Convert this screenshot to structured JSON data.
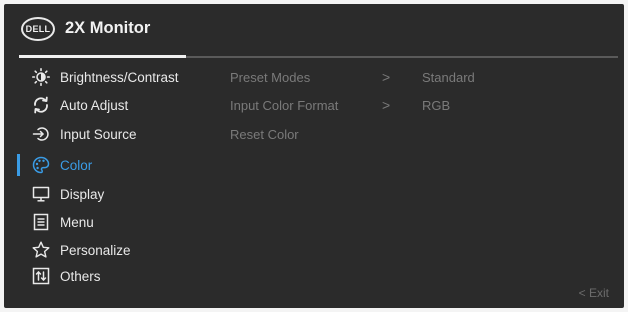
{
  "header": {
    "logo_text": "DELL",
    "title": "2X Monitor"
  },
  "menu": {
    "items": [
      {
        "label": "Brightness/Contrast",
        "icon": "brightness-icon"
      },
      {
        "label": "Auto Adjust",
        "icon": "auto-adjust-icon"
      },
      {
        "label": "Input Source",
        "icon": "input-source-icon"
      },
      {
        "label": "Color",
        "icon": "color-palette-icon",
        "active": true
      },
      {
        "label": "Display",
        "icon": "display-icon"
      },
      {
        "label": "Menu",
        "icon": "menu-icon"
      },
      {
        "label": "Personalize",
        "icon": "star-icon"
      },
      {
        "label": "Others",
        "icon": "others-icon"
      }
    ]
  },
  "submenu": {
    "rows": [
      {
        "label": "Preset Modes",
        "arrow": ">",
        "value": "Standard"
      },
      {
        "label": "Input Color Format",
        "arrow": ">",
        "value": "RGB"
      },
      {
        "label": "Reset Color"
      }
    ]
  },
  "footer": {
    "exit_label": "< Exit"
  },
  "colors": {
    "accent": "#3a9ce6",
    "background": "#2b2b2b",
    "text": "#e9e9e9",
    "dim_text": "#7a7a7a"
  }
}
